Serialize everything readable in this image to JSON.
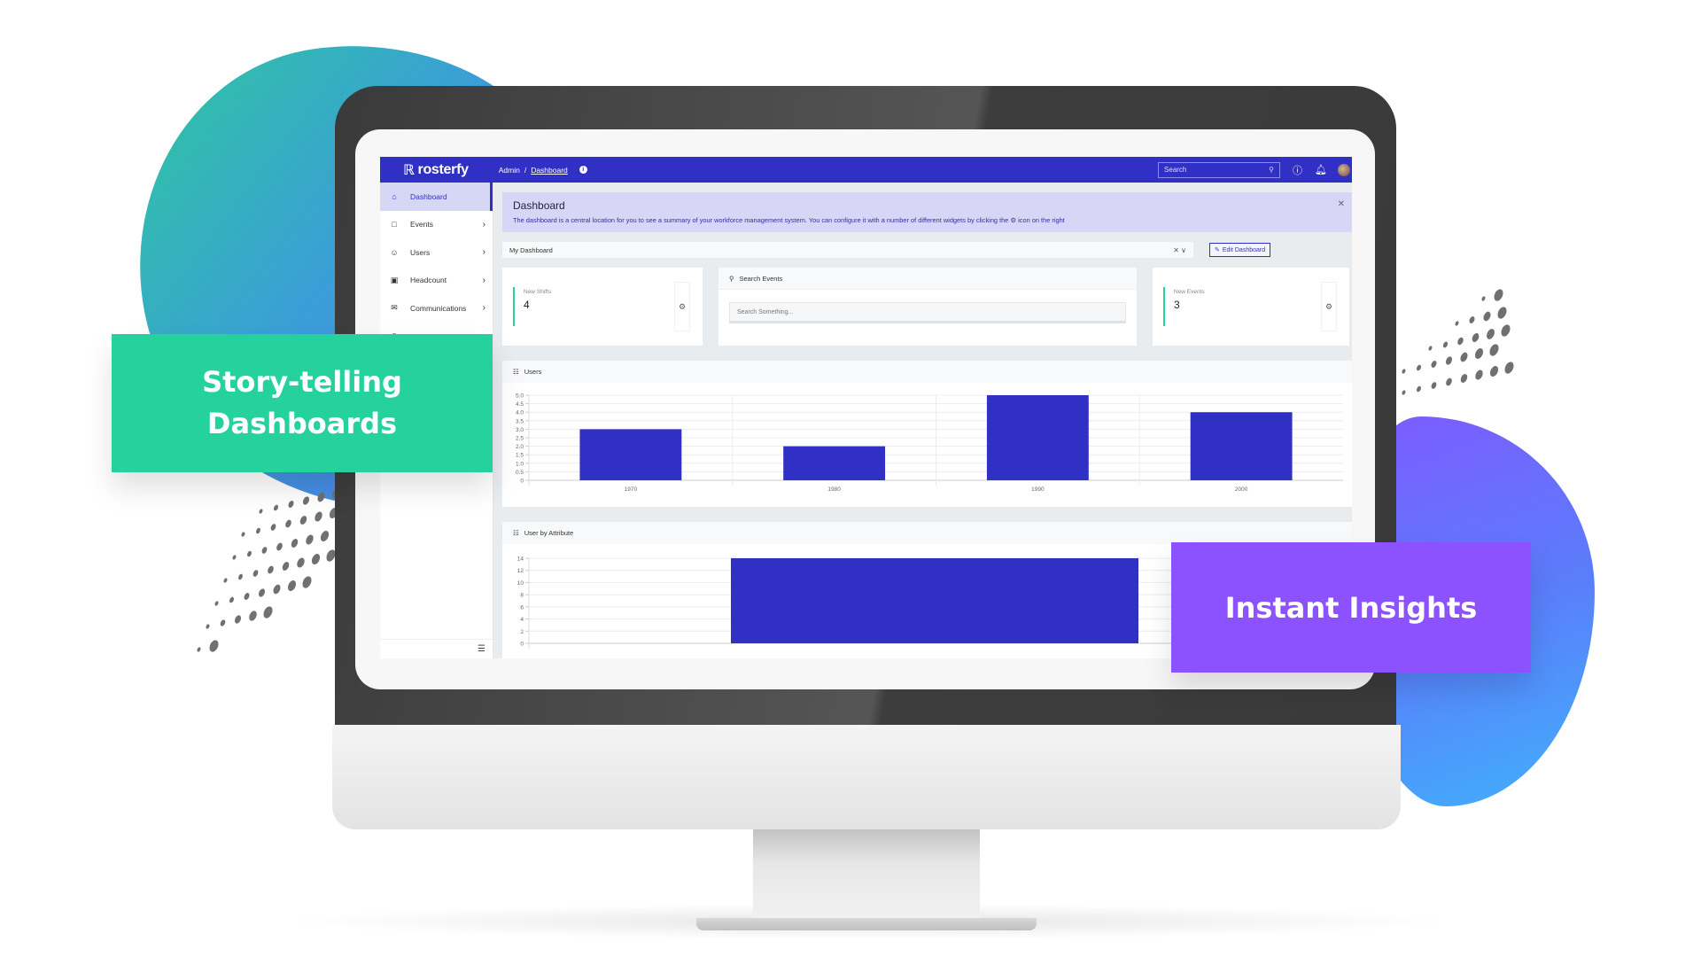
{
  "colors": {
    "brand": "#3030c5",
    "accent_green": "#25d29e",
    "accent_purple": "#8c52ff",
    "bar": "#3030c5"
  },
  "callouts": {
    "left_line1": "Story-telling",
    "left_line2": "Dashboards",
    "right": "Instant Insights"
  },
  "app": {
    "logo_text": "rosterfy",
    "breadcrumb": {
      "root": "Admin",
      "separator": "/",
      "current": "Dashboard"
    },
    "search_placeholder": "Search",
    "icons": {
      "help": "question-circle-icon",
      "notifications": "bell-icon",
      "avatar": "user-avatar"
    }
  },
  "sidebar": {
    "items": [
      {
        "label": "Dashboard",
        "icon": "home-icon",
        "active": true
      },
      {
        "label": "Events",
        "icon": "calendar-icon"
      },
      {
        "label": "Users",
        "icon": "users-icon"
      },
      {
        "label": "Headcount",
        "icon": "briefcase-icon"
      },
      {
        "label": "Communications",
        "icon": "envelope-icon"
      }
    ],
    "collapse_icon": "collapse-menu-icon"
  },
  "banner": {
    "title": "Dashboard",
    "text_before": "The dashboard is a central location for you to see a summary of your workforce management system. You can configure it with a number of different widgets by clicking the",
    "text_after": "icon on the right"
  },
  "dashboard_select": {
    "value": "My Dashboard",
    "edit_label": "Edit Dashboard"
  },
  "widgets": {
    "new_shifts": {
      "label": "New Shifts",
      "value": "4"
    },
    "search_events": {
      "title": "Search Events",
      "placeholder": "Search Something..."
    },
    "new_events": {
      "label": "New Events",
      "value": "3"
    }
  },
  "chart_data": [
    {
      "type": "bar",
      "title": "Users",
      "categories": [
        "1970",
        "1980",
        "1990",
        "2000"
      ],
      "values": [
        3,
        2,
        5,
        4
      ],
      "yticks": [
        "0",
        "0.5",
        "1.0",
        "1.5",
        "2.0",
        "2.5",
        "3.0",
        "3.5",
        "4.0",
        "4.5",
        "5.0"
      ],
      "ylim": [
        0,
        5
      ],
      "xlabel": "",
      "ylabel": "",
      "grid": true
    },
    {
      "type": "bar",
      "title": "User by Attribute",
      "categories": [
        ""
      ],
      "values": [
        14
      ],
      "yticks": [
        "0",
        "2",
        "4",
        "6",
        "8",
        "10",
        "12",
        "14"
      ],
      "ylim": [
        0,
        14
      ],
      "xlabel": "",
      "ylabel": "",
      "grid": true
    }
  ]
}
